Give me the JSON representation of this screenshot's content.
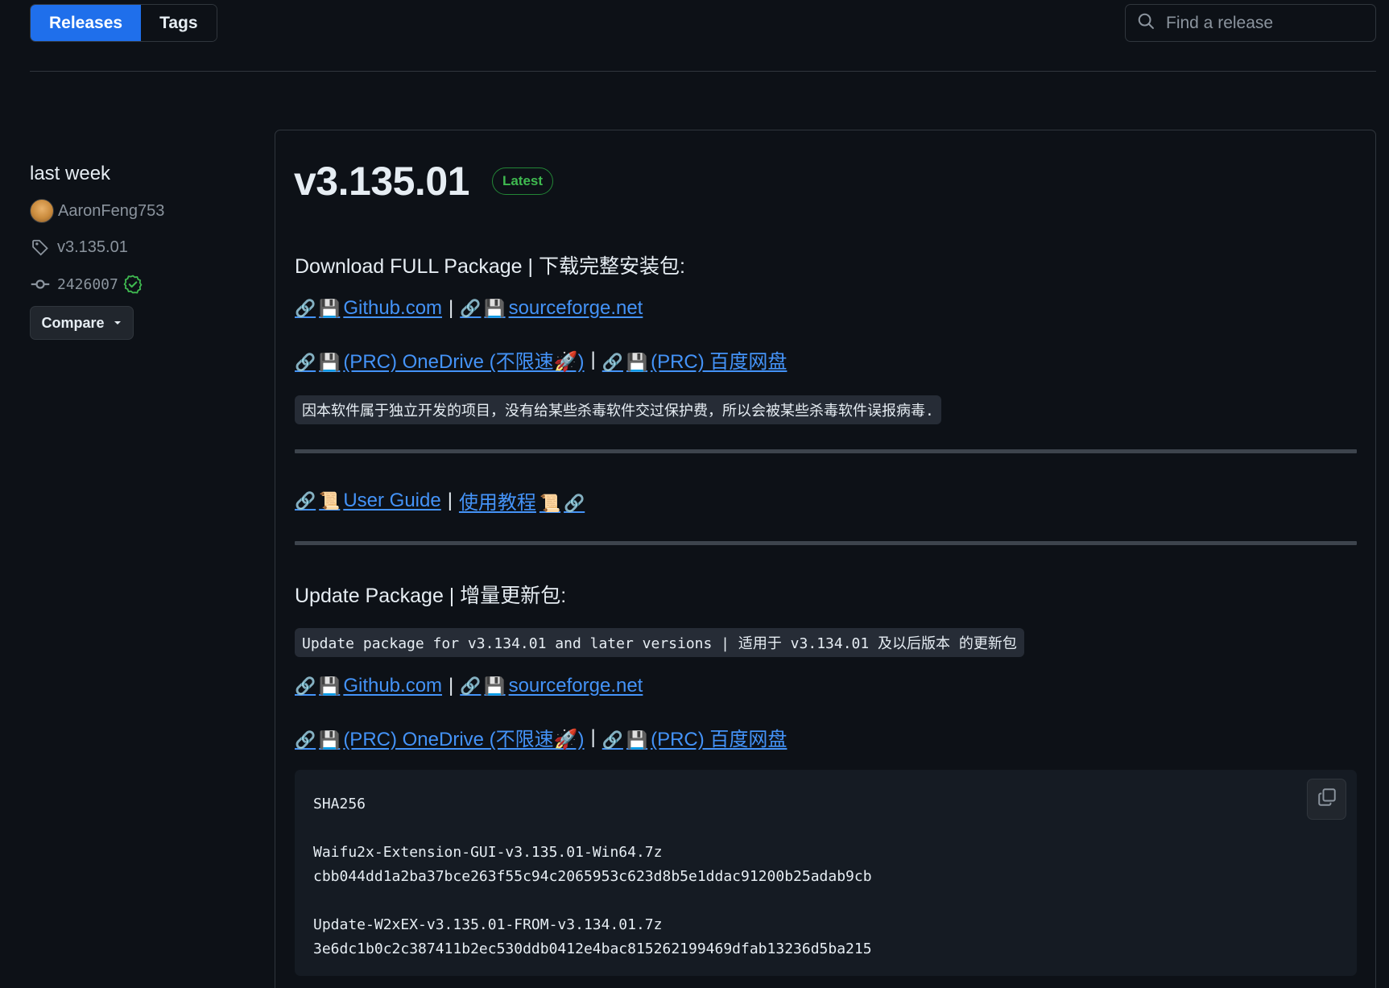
{
  "tabs": [
    {
      "label": "Releases",
      "active": true
    },
    {
      "label": "Tags",
      "active": false
    }
  ],
  "search": {
    "placeholder": "Find a release"
  },
  "sidebar": {
    "date": "last week",
    "author": "AaronFeng753",
    "tag": "v3.135.01",
    "commit": "2426007",
    "compare_label": "Compare"
  },
  "release": {
    "title": "v3.135.01",
    "badge": "Latest",
    "full_heading": "Download FULL Package | 下载完整安装包:",
    "full_links_1": {
      "github": "Github.com",
      "sourceforge": "sourceforge.net"
    },
    "full_links_2": {
      "onedrive": "(PRC) OneDrive (不限速🚀)",
      "baidu": "(PRC) 百度网盘"
    },
    "antivirus_note": "因本软件属于独立开发的项目，没有给某些杀毒软件交过保护费，所以会被某些杀毒软件误报病毒.",
    "guide": {
      "user_guide": "User Guide",
      "tutorial": "使用教程"
    },
    "update_heading": "Update Package | 增量更新包:",
    "update_note": "Update package for v3.134.01 and later versions | 适用于 v3.134.01 及以后版本 的更新包",
    "update_links_1": {
      "github": "Github.com",
      "sourceforge": "sourceforge.net"
    },
    "update_links_2": {
      "onedrive": "(PRC) OneDrive (不限速🚀)",
      "baidu": "(PRC) 百度网盘"
    },
    "sha_block": "SHA256\n\nWaifu2x-Extension-GUI-v3.135.01-Win64.7z\ncbb044dd1a2ba37bce263f55c94c2065953c623d8b5e1ddac91200b25adab9cb\n\nUpdate-W2xEX-v3.135.01-FROM-v3.134.01.7z\n3e6dc1b0c2c387411b2ec530ddb0412e4bac815262199469dfab13236d5ba215"
  },
  "colors": {
    "background": "#0d1117",
    "accent": "#1f6feb",
    "link": "#4493f8",
    "latest_badge": "#3fb950",
    "verified": "#3fb950"
  },
  "icons": [
    "search-icon",
    "tag-icon",
    "commit-icon",
    "verified-check-icon",
    "caret-down-icon",
    "link-icon",
    "floppy-disk-icon",
    "scroll-icon",
    "copy-icon"
  ]
}
